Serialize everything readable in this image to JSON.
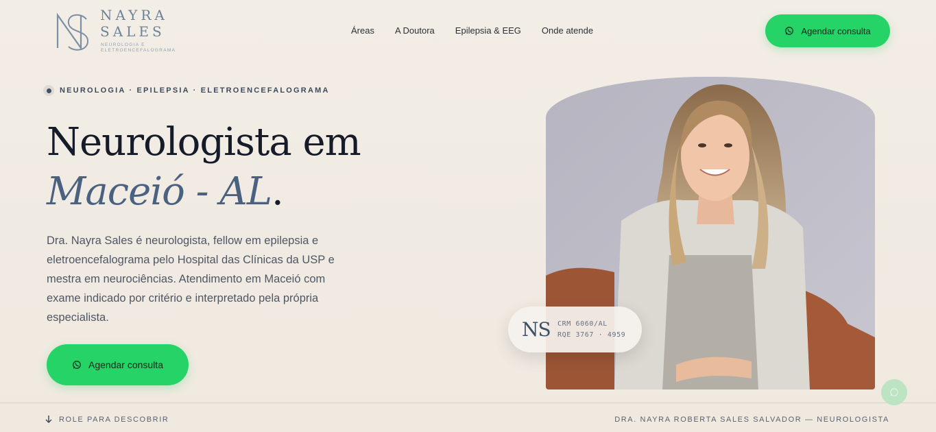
{
  "brand": {
    "name_line1": "NAYRA",
    "name_line2": "SALES",
    "tagline": "NEUROLOGIA E ELETROENCEFALOGRAMA"
  },
  "nav": {
    "items": [
      "Áreas",
      "A Doutora",
      "Epilepsia & EEG",
      "Onde atende"
    ]
  },
  "header": {
    "cta_label": "Agendar consulta"
  },
  "hero": {
    "eyebrow": "NEUROLOGIA · EPILEPSIA · ELETROENCEFALOGRAMA",
    "title_line1": "Neurologista em",
    "title_line2": "Maceió - AL",
    "title_period": ".",
    "description": "Dra. Nayra Sales é neurologista, fellow em epilepsia e eletroencefalograma pelo Hospital das Clínicas da USP e mestra em neurociências. Atendimento em Maceió com exame indicado por critério e interpretado pela própria especialista.",
    "cta_label": "Agendar consulta"
  },
  "credential": {
    "monogram": "NS",
    "crm": "CRM 6060/AL",
    "rqe": "RQE 3767 · 4959"
  },
  "footer": {
    "scroll_label": "ROLE PARA DESCOBRIR",
    "doctor_label": "DRA. NAYRA ROBERTA SALES SALVADOR — NEUROLOGISTA"
  },
  "colors": {
    "accent_green": "#25d366",
    "title_dark": "#151b28",
    "title_italic": "#4a6280",
    "background": "#f0ebe3"
  },
  "icons": [
    "whatsapp-icon",
    "arrow-down-icon",
    "logo-mark-icon"
  ]
}
